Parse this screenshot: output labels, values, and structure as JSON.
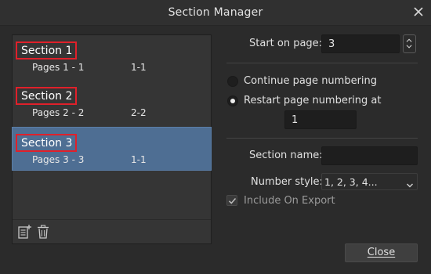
{
  "window": {
    "title": "Section Manager"
  },
  "sections": [
    {
      "title": "Section 1",
      "pages": "Pages 1 - 1",
      "range": "1-1",
      "selected": false
    },
    {
      "title": "Section 2",
      "pages": "Pages 2 - 2",
      "range": "2-2",
      "selected": false
    },
    {
      "title": "Section 3",
      "pages": "Pages 3 - 3",
      "range": "1-1",
      "selected": true
    }
  ],
  "list_toolbar": {
    "icons": [
      "add-section-icon",
      "delete-section-icon"
    ]
  },
  "settings": {
    "start_on_page_label": "Start on page:",
    "start_on_page_value": "3",
    "continue_numbering_label": "Continue page numbering",
    "restart_numbering_label": "Restart page numbering at",
    "restart_value": "1",
    "numbering_mode": "restart",
    "section_name_label": "Section name:",
    "section_name_value": "",
    "number_style_label": "Number style:",
    "number_style_value": "1, 2, 3, 4...",
    "include_on_export_label": "Include On Export",
    "include_on_export_checked": true
  },
  "footer": {
    "close_label": "Close"
  },
  "colors": {
    "selected_row": "#4e6e93",
    "highlight_border": "#e0202a"
  }
}
